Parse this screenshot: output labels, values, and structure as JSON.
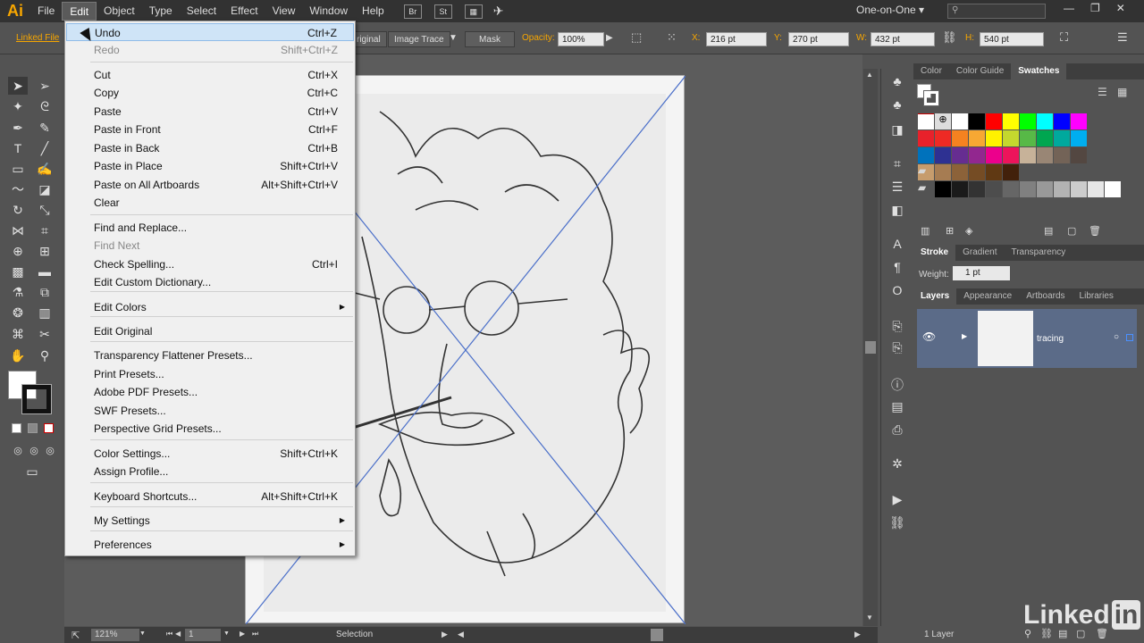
{
  "app": {
    "logo": "Ai",
    "workspace": "One-on-One ▾"
  },
  "menubar": [
    "File",
    "Edit",
    "Object",
    "Type",
    "Select",
    "Effect",
    "View",
    "Window",
    "Help"
  ],
  "menubar_buttons": [
    "Br",
    "St"
  ],
  "control": {
    "linked_file": "Linked File",
    "original_tail": "riginal",
    "image_trace": "Image Trace",
    "mask": "Mask",
    "opacity_label": "Opacity:",
    "opacity": "100%",
    "x_label": "X:",
    "x": "216 pt",
    "y_label": "Y:",
    "y": "270 pt",
    "w_label": "W:",
    "w": "432 pt",
    "h_label": "H:",
    "h": "540 pt"
  },
  "edit_menu": [
    {
      "label": "Undo",
      "shortcut": "Ctrl+Z",
      "state": "highlight"
    },
    {
      "label": "Redo",
      "shortcut": "Shift+Ctrl+Z",
      "state": "disabled"
    },
    {
      "label": "Cut",
      "shortcut": "Ctrl+X"
    },
    {
      "label": "Copy",
      "shortcut": "Ctrl+C"
    },
    {
      "label": "Paste",
      "shortcut": "Ctrl+V"
    },
    {
      "label": "Paste in Front",
      "shortcut": "Ctrl+F"
    },
    {
      "label": "Paste in Back",
      "shortcut": "Ctrl+B"
    },
    {
      "label": "Paste in Place",
      "shortcut": "Shift+Ctrl+V"
    },
    {
      "label": "Paste on All Artboards",
      "shortcut": "Alt+Shift+Ctrl+V"
    },
    {
      "label": "Clear",
      "shortcut": ""
    },
    {
      "label": "Find and Replace...",
      "shortcut": ""
    },
    {
      "label": "Find Next",
      "shortcut": "",
      "state": "disabled"
    },
    {
      "label": "Check Spelling...",
      "shortcut": "Ctrl+I"
    },
    {
      "label": "Edit Custom Dictionary...",
      "shortcut": ""
    },
    {
      "label": "Edit Colors",
      "shortcut": "",
      "submenu": true
    },
    {
      "label": "Edit Original",
      "shortcut": ""
    },
    {
      "label": "Transparency Flattener Presets...",
      "shortcut": ""
    },
    {
      "label": "Print Presets...",
      "shortcut": ""
    },
    {
      "label": "Adobe PDF Presets...",
      "shortcut": ""
    },
    {
      "label": "SWF Presets...",
      "shortcut": ""
    },
    {
      "label": "Perspective Grid Presets...",
      "shortcut": ""
    },
    {
      "label": "Color Settings...",
      "shortcut": "Shift+Ctrl+K"
    },
    {
      "label": "Assign Profile...",
      "shortcut": ""
    },
    {
      "label": "Keyboard Shortcuts...",
      "shortcut": "Alt+Shift+Ctrl+K"
    },
    {
      "label": "My Settings",
      "shortcut": "",
      "submenu": true
    },
    {
      "label": "Preferences",
      "shortcut": "",
      "submenu": true
    }
  ],
  "panels": {
    "color_tabs": [
      "Color",
      "Color Guide",
      "Swatches"
    ],
    "stroke_tabs": [
      "Stroke",
      "Gradient",
      "Transparency"
    ],
    "weight_label": "Weight:",
    "weight": "1 pt",
    "layer_tabs": [
      "Layers",
      "Appearance",
      "Artboards",
      "Libraries"
    ],
    "layer_name": "tracing",
    "layer_count": "1 Layer"
  },
  "status": {
    "zoom": "121%",
    "page": "1",
    "tool": "Selection"
  },
  "watermark": "Linked",
  "watermark_box": "in",
  "swatches": [
    "#ffffff",
    "#000000",
    "#ff0000",
    "#ffff00",
    "#00ff00",
    "#00ffff",
    "#0000ff",
    "#ff00ff",
    "#e8212b",
    "#ee2a24",
    "#f58220",
    "#f7a833",
    "#fff200",
    "#c4d82e",
    "#57b947",
    "#00a650",
    "#00a99d",
    "#00aeef",
    "#0072bc",
    "#2e3192",
    "#662d91",
    "#92278f",
    "#ec008c",
    "#ed145b",
    "#c7b299",
    "#998675",
    "#736357",
    "#534741",
    "#c69c6d",
    "#a67c52",
    "#8c6239",
    "#754c24",
    "#603913",
    "#42210b",
    "#ffffff",
    "#b2e5f0",
    "#7ad3dc",
    "#7c8fd0",
    "#a48cd3",
    "#000000",
    "#1a1a1a",
    "#333333",
    "#4d4d4d",
    "#666666",
    "#808080",
    "#999999",
    "#b3b3b3",
    "#cccccc",
    "#e6e6e6",
    "#ffffff"
  ]
}
